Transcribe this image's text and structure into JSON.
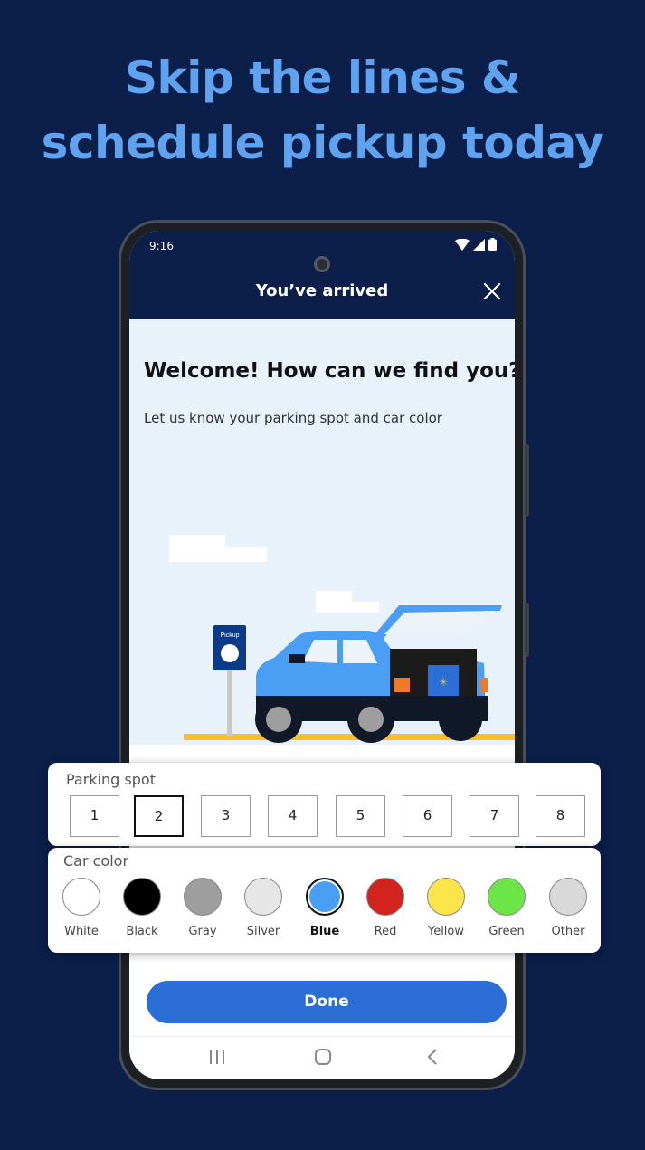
{
  "headline": {
    "line1": "Skip the lines &",
    "line2": "schedule pickup today"
  },
  "status_bar": {
    "time": "9:16"
  },
  "header": {
    "title": "You’ve arrived"
  },
  "main": {
    "welcome": "Welcome! How can we find you?",
    "subtitle": "Let us know your parking spot and car color",
    "sign_label": "Pickup"
  },
  "parking": {
    "label": "Parking spot",
    "spots": [
      "1",
      "2",
      "3",
      "4",
      "5",
      "6",
      "7",
      "8"
    ],
    "selected": "2"
  },
  "car_color": {
    "label": "Car color",
    "options": [
      {
        "label": "White",
        "color": "#ffffff"
      },
      {
        "label": "Black",
        "color": "#000000"
      },
      {
        "label": "Gray",
        "color": "#9e9e9e"
      },
      {
        "label": "Silver",
        "color": "#e6e6e6"
      },
      {
        "label": "Blue",
        "color": "#4a9ff5"
      },
      {
        "label": "Red",
        "color": "#d2231f"
      },
      {
        "label": "Yellow",
        "color": "#fbe54a"
      },
      {
        "label": "Green",
        "color": "#6be646"
      },
      {
        "label": "Other",
        "color": "#d9d9d9"
      }
    ],
    "selected": "Blue"
  },
  "done_label": "Done",
  "colors": {
    "background": "#0b1f4a",
    "headline": "#5fa3f0",
    "primary_button": "#2b6fd6",
    "illustration_bg": "#e9f1fb",
    "car": "#4a9ff5"
  }
}
